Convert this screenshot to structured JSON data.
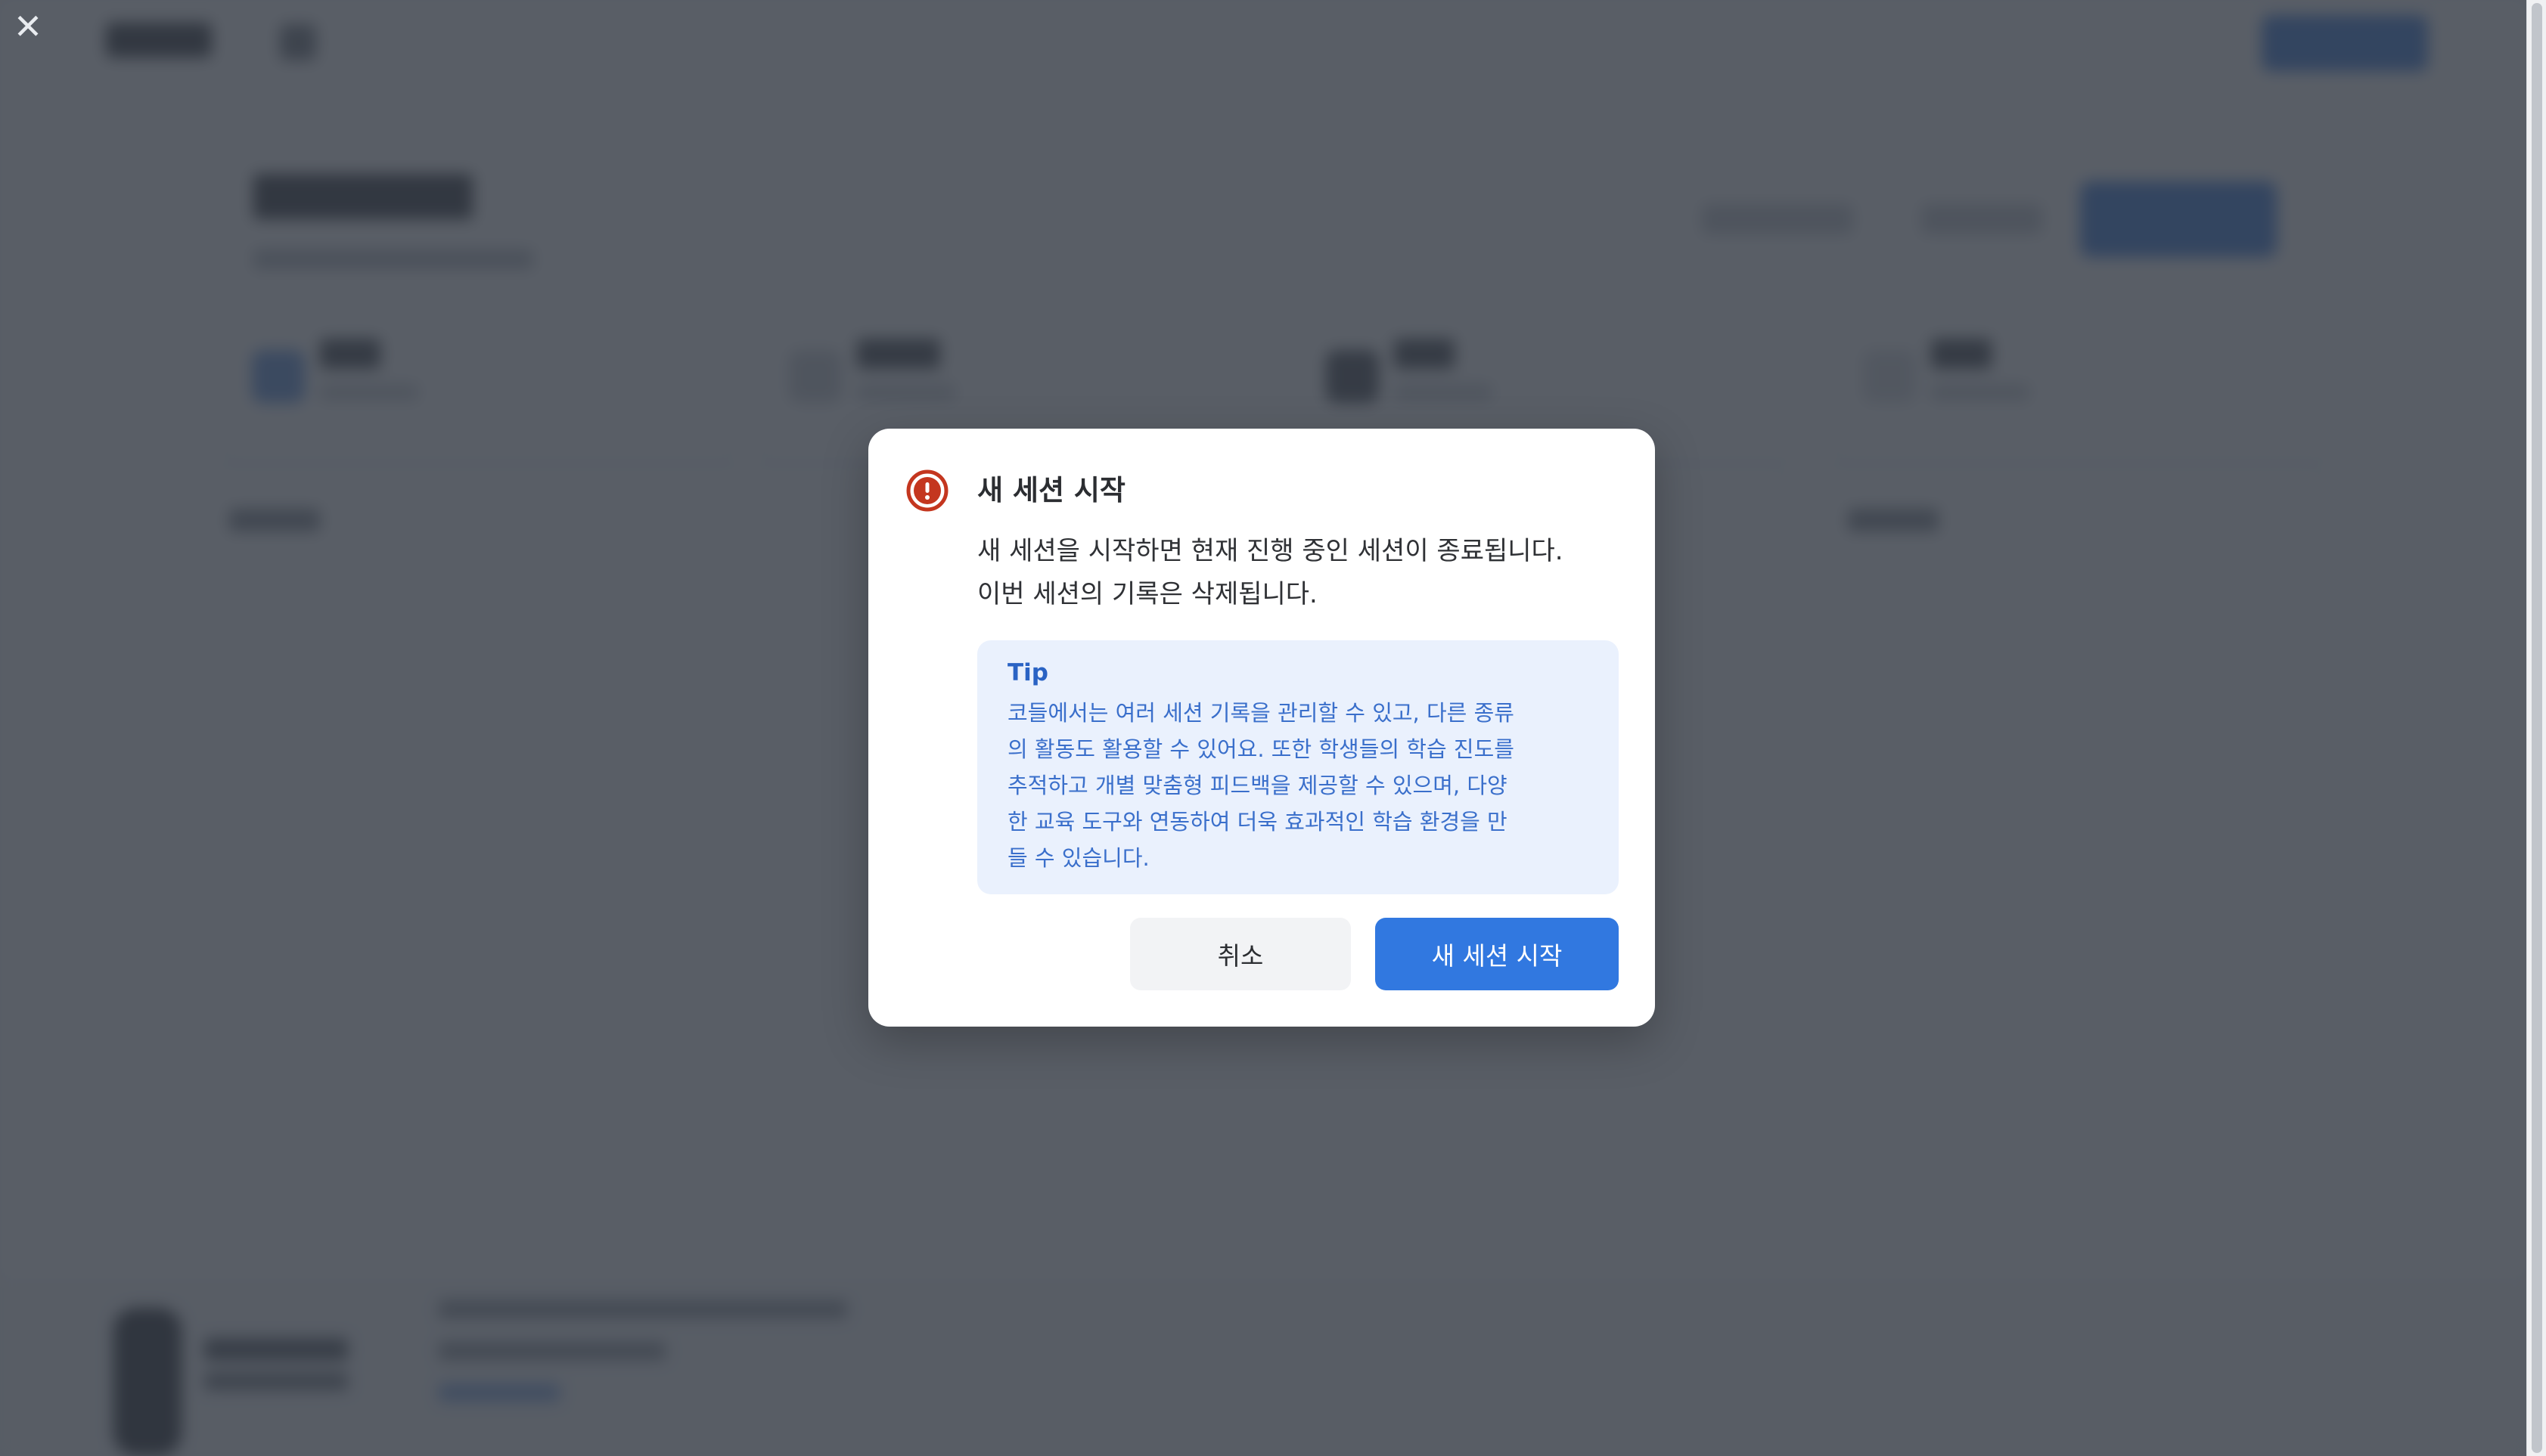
{
  "overlay": {
    "close_icon": "close-icon",
    "close_glyph": "✕"
  },
  "dialog": {
    "icon": "alert-circle-icon",
    "title": "새 세션 시작",
    "message_lines": [
      "새 세션을 시작하면 현재 진행 중인 세션이 종료됩니다.",
      "이번 세션의 기록은 삭제됩니다."
    ],
    "tip": {
      "title": "Tip",
      "lines": [
        "코들에서는 여러 세션 기록을 관리할 수 있고, 다른 종류",
        "의 활동도 활용할 수 있어요. 또한 학생들의 학습 진도를",
        "추적하고 개별 맞춤형 피드백을 제공할 수 있으며, 다양",
        "한 교육 도구와 연동하여 더욱 효과적인 학습 환경을 만",
        "들 수 있습니다."
      ]
    },
    "cancel_label": "취소",
    "confirm_label": "새 세션 시작"
  },
  "colors": {
    "overlay": "#343a44",
    "dialog_bg": "#ffffff",
    "warning_icon": "#c4361f",
    "tip_bg": "#eaf1fd",
    "tip_text": "#3a6fcb",
    "primary": "#3178e0",
    "secondary_bg": "#f2f3f5"
  }
}
